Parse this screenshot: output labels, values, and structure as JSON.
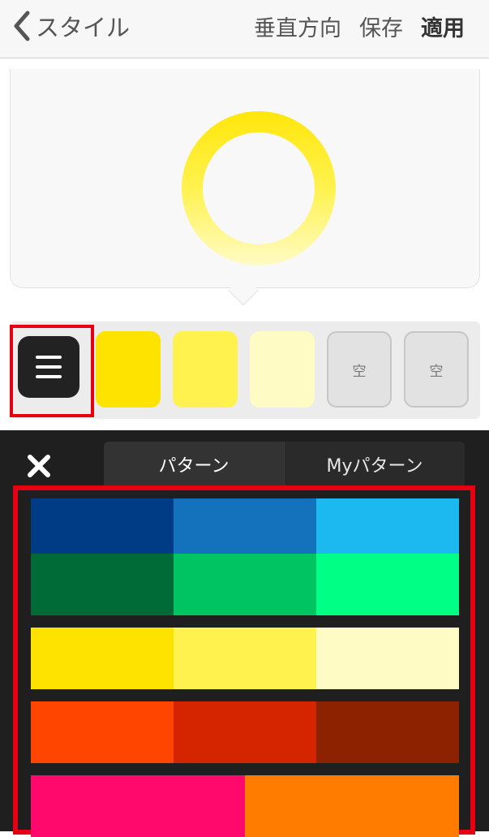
{
  "header": {
    "back_label": "スタイル",
    "vertical_label": "垂直方向",
    "save_label": "保存",
    "apply_label": "適用"
  },
  "preview": {
    "ring_colors": [
      "#ffe60a",
      "#fff24f",
      "#fffbc4"
    ]
  },
  "swatches": {
    "colors": [
      "#ffe300",
      "#fff24f",
      "#fffbc4"
    ],
    "empty_label": "空"
  },
  "palette_panel": {
    "tabs": [
      {
        "label": "パターン",
        "active": true
      },
      {
        "label": "Myパターン",
        "active": false
      }
    ],
    "palettes": [
      {
        "colors": [
          "#003c85",
          "#1472bd",
          "#1bb9f0"
        ]
      },
      {
        "colors": [
          "#006b37",
          "#00c462",
          "#00ff85"
        ]
      },
      {
        "colors": [
          "#ffe300",
          "#fff24f",
          "#fffbc4"
        ]
      },
      {
        "colors": [
          "#ff4500",
          "#d42400",
          "#8c2200"
        ]
      },
      {
        "colors": [
          "#ff0a6c",
          "#ff7c00"
        ]
      }
    ]
  }
}
